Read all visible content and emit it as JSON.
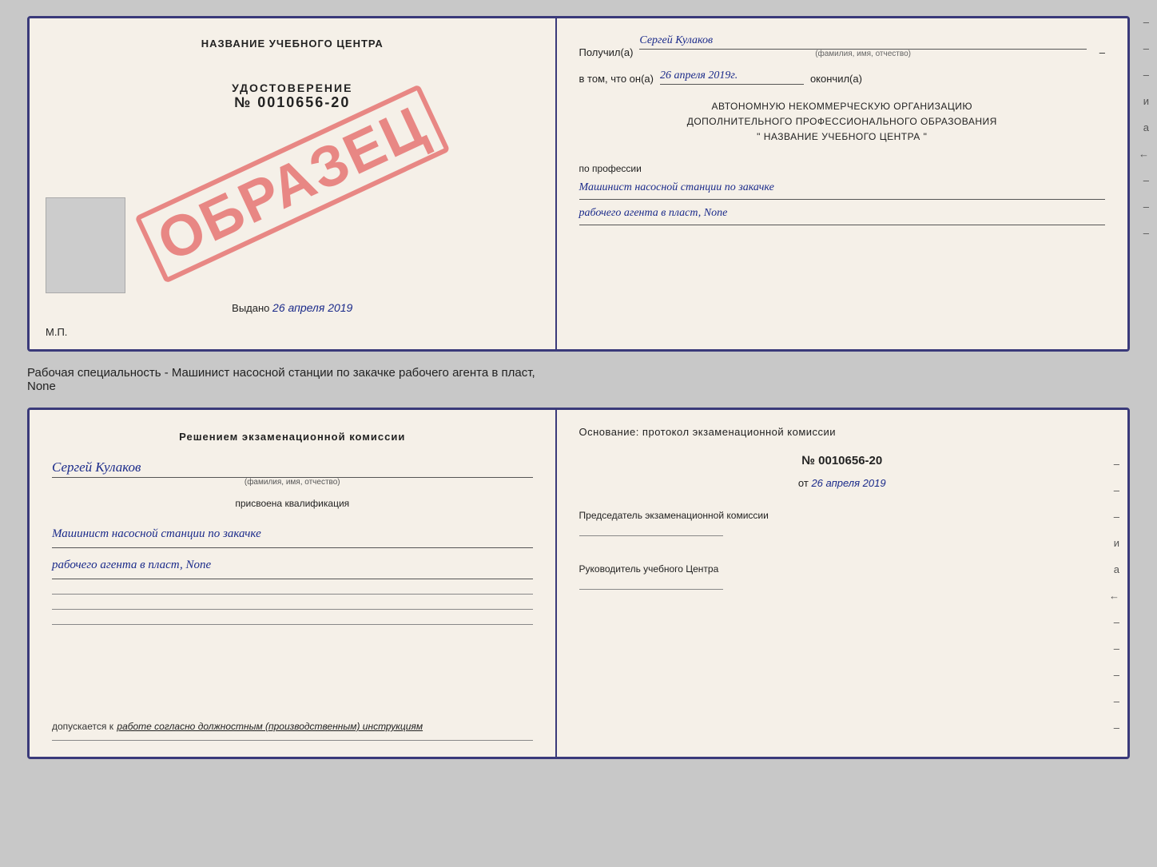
{
  "page": {
    "background": "#c8c8c8"
  },
  "top_doc": {
    "left": {
      "center_title": "НАЗВАНИЕ УЧЕБНОГО ЦЕНТРА",
      "udostoverenie_title": "УДОСТОВЕРЕНИЕ",
      "number": "№ 0010656-20",
      "stamp": "ОБРАЗЕЦ",
      "vydano_label": "Выдано",
      "vydano_date": "26 апреля 2019",
      "mp_label": "М.П."
    },
    "right": {
      "poluchil_label": "Получил(а)",
      "poluchil_value": "Сергей Кулаков",
      "familiya_label": "(фамилия, имя, отчество)",
      "vtom_label": "в том, что он(а)",
      "vtom_value": "26 апреля 2019г.",
      "okoncil_label": "окончил(а)",
      "org_line1": "АВТОНОМНУЮ НЕКОММЕРЧЕСКУЮ ОРГАНИЗАЦИЮ",
      "org_line2": "ДОПОЛНИТЕЛЬНОГО ПРОФЕССИОНАЛЬНОГО ОБРАЗОВАНИЯ",
      "org_line3": "\"   НАЗВАНИЕ УЧЕБНОГО ЦЕНТРА   \"",
      "po_professii_label": "по профессии",
      "profession_line1": "Машинист насосной станции по закачке",
      "profession_line2": "рабочего агента в пласт, None",
      "dashes": [
        "-",
        "-",
        "-",
        "и",
        "а",
        "←",
        "-",
        "-",
        "-"
      ]
    }
  },
  "specialty_label": "Рабочая специальность - Машинист насосной станции по закачке рабочего агента в пласт,",
  "specialty_label2": "None",
  "bottom_doc": {
    "left": {
      "komissia_title": "Решением экзаменационной комиссии",
      "name_value": "Сергей Кулаков",
      "name_sub": "(фамилия, имя, отчество)",
      "prisvoena": "присвоена квалификация",
      "qual_line1": "Машинист насосной станции по закачке",
      "qual_line2": "рабочего агента в пласт, None",
      "dopusk_label": "допускается к",
      "dopusk_value": "работе согласно должностным (производственным) инструкциям"
    },
    "right": {
      "osnovanie_label": "Основание: протокол экзаменационной комиссии",
      "number": "№  0010656-20",
      "ot_label": "от",
      "ot_date": "26 апреля 2019",
      "predsedatel_label": "Председатель экзаменационной комиссии",
      "rukovoditel_label": "Руководитель учебного Центра",
      "dashes": [
        "-",
        "-",
        "-",
        "и",
        "а",
        "←",
        "-",
        "-",
        "-",
        "-",
        "-"
      ]
    }
  }
}
